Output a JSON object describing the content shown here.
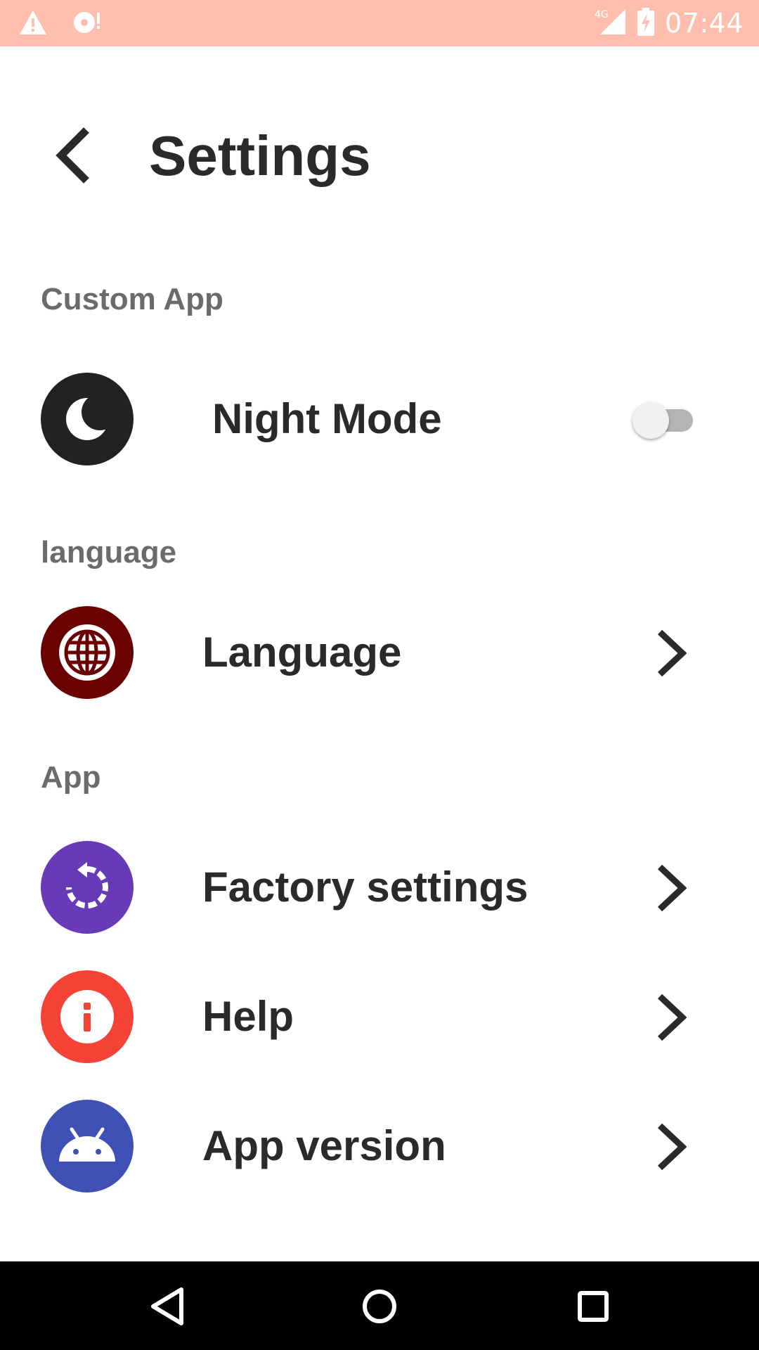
{
  "status_bar": {
    "time": "07:44",
    "network": "4G",
    "left_icons": [
      "warning-icon",
      "sd-card-alert-icon"
    ],
    "right_icons": [
      "signal-icon",
      "battery-charging-icon"
    ],
    "background": "#ffbfaf"
  },
  "header": {
    "title": "Settings",
    "back_icon": "back-chevron-icon"
  },
  "sections": [
    {
      "title": "Custom App",
      "items": [
        {
          "label": "Night Mode",
          "icon": "moon-icon",
          "icon_bg": "#222222",
          "control": "toggle",
          "toggle_on": false
        }
      ]
    },
    {
      "title": "language",
      "items": [
        {
          "label": "Language",
          "icon": "globe-icon",
          "icon_bg": "#6b0000",
          "control": "chevron"
        }
      ]
    },
    {
      "title": "App",
      "items": [
        {
          "label": "Factory settings",
          "icon": "restore-icon",
          "icon_bg": "#673ab7",
          "control": "chevron"
        },
        {
          "label": "Help",
          "icon": "info-icon",
          "icon_bg": "#f44336",
          "control": "chevron"
        },
        {
          "label": "App version",
          "icon": "android-icon",
          "icon_bg": "#3f51b5",
          "control": "chevron"
        }
      ]
    }
  ],
  "nav_bar": {
    "buttons": [
      "back-triangle-icon",
      "home-circle-icon",
      "recents-square-icon"
    ]
  }
}
